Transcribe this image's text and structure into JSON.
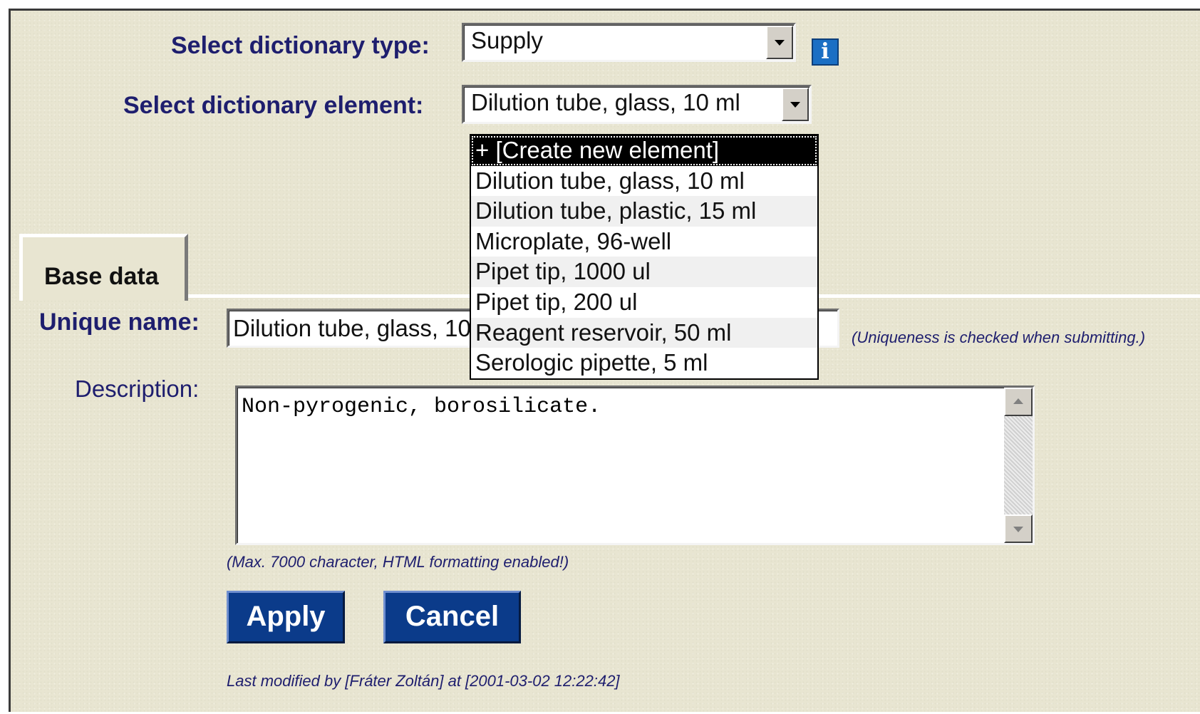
{
  "dictionary_type": {
    "label": "Select dictionary type:",
    "value": "Supply",
    "info_icon": "info-icon"
  },
  "dictionary_element": {
    "label": "Select dictionary element:",
    "value": "Dilution tube, glass, 10 ml",
    "options": [
      "+ [Create new element]",
      "Dilution tube, glass, 10 ml",
      "Dilution tube, plastic, 15 ml",
      "Microplate, 96-well",
      "Pipet tip, 1000 ul",
      "Pipet tip, 200 ul",
      "Reagent reservoir, 50 ml",
      "Serologic pipette, 5 ml"
    ],
    "highlighted_index": 0
  },
  "tabs": [
    {
      "label": "Base data",
      "active": true
    }
  ],
  "form": {
    "unique_name_label": "Unique name:",
    "unique_name_value": "Dilution tube, glass, 10 ml",
    "uniqueness_note": "(Uniqueness is checked when submitting.)",
    "description_label": "Description:",
    "description_value": "Non-pyrogenic, borosilicate.",
    "description_note": "(Max. 7000 character, HTML formatting enabled!)",
    "apply_label": "Apply",
    "cancel_label": "Cancel",
    "last_modified": "Last modified by [Fráter Zoltán] at [2001-03-02 12:22:42]"
  },
  "colors": {
    "label_text": "#1e1e6e",
    "button_bg": "#0b3b8a",
    "background": "#e8e5d1",
    "info_icon": "#1b6fc4"
  }
}
